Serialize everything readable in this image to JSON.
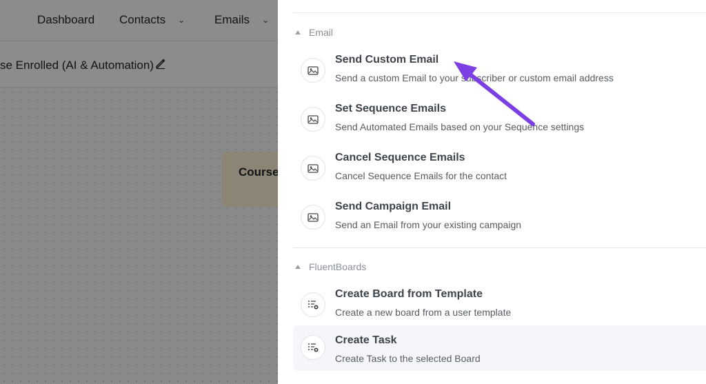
{
  "nav": {
    "dashboard": "Dashboard",
    "contacts": "Contacts",
    "emails": "Emails"
  },
  "page": {
    "title": "se Enrolled (AI & Automation)",
    "trigger_card": "Course"
  },
  "drawer": {
    "sections": [
      {
        "label": "Email",
        "actions": [
          {
            "title": "Send Custom Email",
            "desc": "Send a custom Email to your subscriber or custom email address",
            "icon": "email-image-icon"
          },
          {
            "title": "Set Sequence Emails",
            "desc": "Send Automated Emails based on your Sequence settings",
            "icon": "email-image-icon"
          },
          {
            "title": "Cancel Sequence Emails",
            "desc": "Cancel Sequence Emails for the contact",
            "icon": "email-image-icon"
          },
          {
            "title": "Send Campaign Email",
            "desc": "Send an Email from your existing campaign",
            "icon": "email-image-icon"
          }
        ]
      },
      {
        "label": "FluentBoards",
        "actions": [
          {
            "title": "Create Board from Template",
            "desc": "Create a new board from a user template",
            "icon": "board-task-icon"
          },
          {
            "title": "Create Task",
            "desc": "Create Task to the selected Board",
            "icon": "board-task-icon"
          }
        ]
      }
    ]
  },
  "colors": {
    "annotation_arrow": "#7b3fe4",
    "overlay": "#000000",
    "trigger_card_bg": "#fff3d6"
  }
}
